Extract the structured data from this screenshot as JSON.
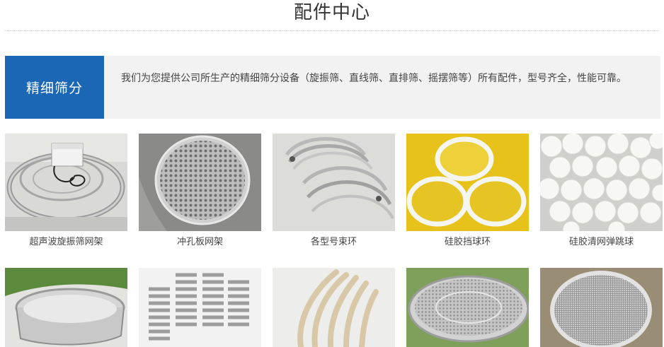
{
  "header": {
    "title": "配件中心"
  },
  "category": {
    "name": "精细筛分",
    "description": "我们为您提供公司所生产的精细筛分设备（旋振筛、直线筛、直排筛、摇摆筛等）所有配件，型号齐全，性能可靠。"
  },
  "products_row1": [
    {
      "caption": "超声波旋振筛网架"
    },
    {
      "caption": "冲孔板网架"
    },
    {
      "caption": "各型号束环"
    },
    {
      "caption": "硅胶挡球环"
    },
    {
      "caption": "硅胶清网弹跳球"
    }
  ],
  "colors": {
    "category_bg": "#1c66b6",
    "intro_bg": "#f2f2f2",
    "yellow_mesh": "#e6c21a"
  }
}
